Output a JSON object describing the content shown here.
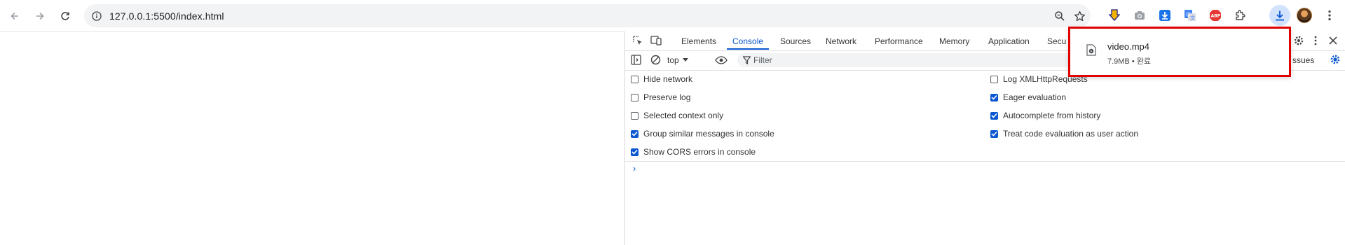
{
  "browser": {
    "url": "127.0.0.1:5500/index.html",
    "icons": [
      "back-icon",
      "forward-icon",
      "reload-icon",
      "site-info-icon",
      "zoom-icon",
      "bookmark-star-icon"
    ],
    "extensions": [
      "download-arrow-extension-icon",
      "camera-extension-icon",
      "download-box-extension-icon",
      "translate-extension-icon",
      "adblock-plus-icon",
      "puzzle-extensions-icon",
      "downloads-icon",
      "profile-avatar",
      "more-menu-icon"
    ]
  },
  "devtools": {
    "tabs": [
      "Elements",
      "Console",
      "Sources",
      "Network",
      "Performance",
      "Memory",
      "Application",
      "Secu"
    ],
    "active_tab": "Console",
    "context": "top",
    "filter_placeholder": "Filter",
    "issues_partial": "ssues",
    "settings_left": [
      {
        "label": "Hide network",
        "checked": false
      },
      {
        "label": "Preserve log",
        "checked": false
      },
      {
        "label": "Selected context only",
        "checked": false
      },
      {
        "label": "Group similar messages in console",
        "checked": true
      },
      {
        "label": "Show CORS errors in console",
        "checked": true
      }
    ],
    "settings_right": [
      {
        "label": "Log XMLHttpRequests",
        "checked": false
      },
      {
        "label": "Eager evaluation",
        "checked": true
      },
      {
        "label": "Autocomplete from history",
        "checked": true
      },
      {
        "label": "Treat code evaluation as user action",
        "checked": true
      }
    ],
    "prompt": "›"
  },
  "download": {
    "file_name": "video.mp4",
    "size": "7.9MB",
    "separator": "•",
    "status": "완료"
  },
  "colors": {
    "accent": "#0b57d0",
    "highlight_border": "#e00000"
  }
}
